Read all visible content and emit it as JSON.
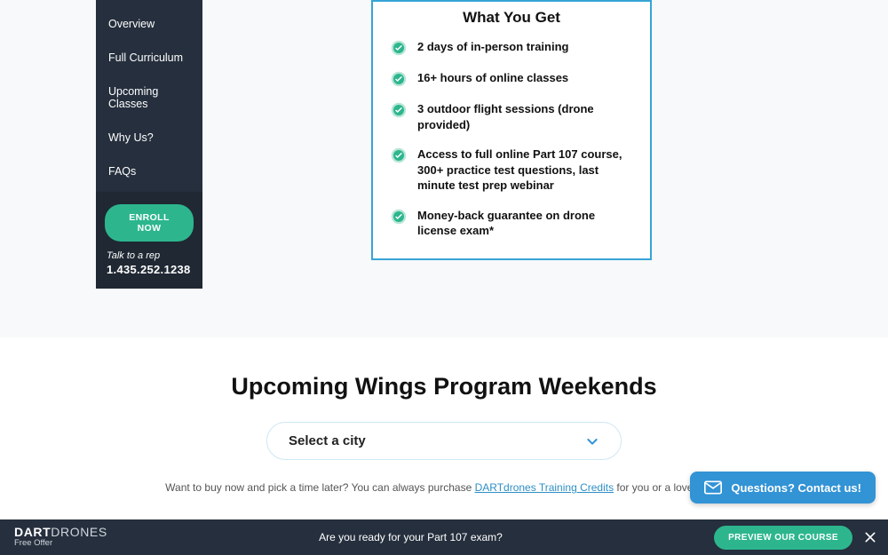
{
  "sidebar": {
    "items": [
      "Overview",
      "Full Curriculum",
      "Upcoming Classes",
      "Why Us?",
      "FAQs"
    ],
    "enroll_label": "ENROLL NOW",
    "talk_label": "Talk to a rep",
    "phone": "1.435.252.1238"
  },
  "wyg": {
    "title": "What You Get",
    "items": [
      "2 days of in-person training",
      "16+ hours of online classes",
      "3 outdoor flight sessions (drone provided)",
      "Access to full online Part 107 course, 300+ practice test questions, last minute test prep webinar",
      "Money-back guarantee on drone license exam*"
    ]
  },
  "upcoming": {
    "title": "Upcoming Wings Program Weekends",
    "select_label": "Select a city",
    "sub_pre": "Want to buy now and pick a time later? You can always purchase ",
    "credits_link": "DARTdrones Training Credits",
    "sub_post": " for you or a loved one."
  },
  "chat": {
    "label": "Questions? Contact us!"
  },
  "bottom": {
    "brand_bold": "DART",
    "brand_light": "DRONES",
    "free_offer": "Free Offer",
    "question": "Are you ready for your Part 107 exam?",
    "preview_label": "PREVIEW OUR COURSE"
  }
}
